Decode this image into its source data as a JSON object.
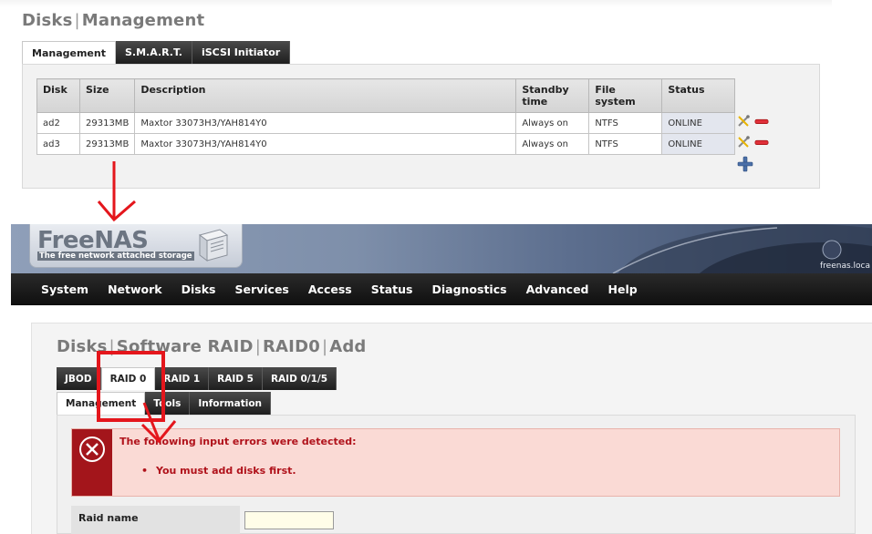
{
  "top": {
    "title_part1": "Disks",
    "title_part2": "Management",
    "tabs": [
      {
        "label": "Management"
      },
      {
        "label": "S.M.A.R.T."
      },
      {
        "label": "iSCSI Initiator"
      }
    ],
    "table": {
      "headers": [
        "Disk",
        "Size",
        "Description",
        "Standby time",
        "File system",
        "Status"
      ],
      "rows": [
        {
          "disk": "ad2",
          "size": "29313MB",
          "description": "Maxtor 33073H3/YAH814Y0",
          "standby": "Always on",
          "fs": "NTFS",
          "status": "ONLINE"
        },
        {
          "disk": "ad3",
          "size": "29313MB",
          "description": "Maxtor 33073H3/YAH814Y0",
          "standby": "Always on",
          "fs": "NTFS",
          "status": "ONLINE"
        }
      ]
    }
  },
  "freenas": {
    "logo": "FreeNAS",
    "tagline": "The free network attached storage",
    "hostname": "freenas.loca",
    "nav": [
      "System",
      "Network",
      "Disks",
      "Services",
      "Access",
      "Status",
      "Diagnostics",
      "Advanced",
      "Help"
    ]
  },
  "raid_page": {
    "title_parts": [
      "Disks",
      "Software RAID",
      "RAID0",
      "Add"
    ],
    "raid_tabs": [
      "JBOD",
      "RAID 0",
      "RAID 1",
      "RAID 5",
      "RAID 0/1/5"
    ],
    "sub_tabs": [
      "Management",
      "Tools",
      "Information"
    ],
    "error_title": "The following input errors were detected:",
    "error_items": [
      "You must add disks first."
    ],
    "raid_name_label": "Raid name",
    "raid_name_value": ""
  },
  "colors": {
    "accent_red": "#e4161c",
    "error_side": "#a3151b",
    "error_bg": "#fadad5",
    "tab_dark": "#1e1e1e"
  }
}
